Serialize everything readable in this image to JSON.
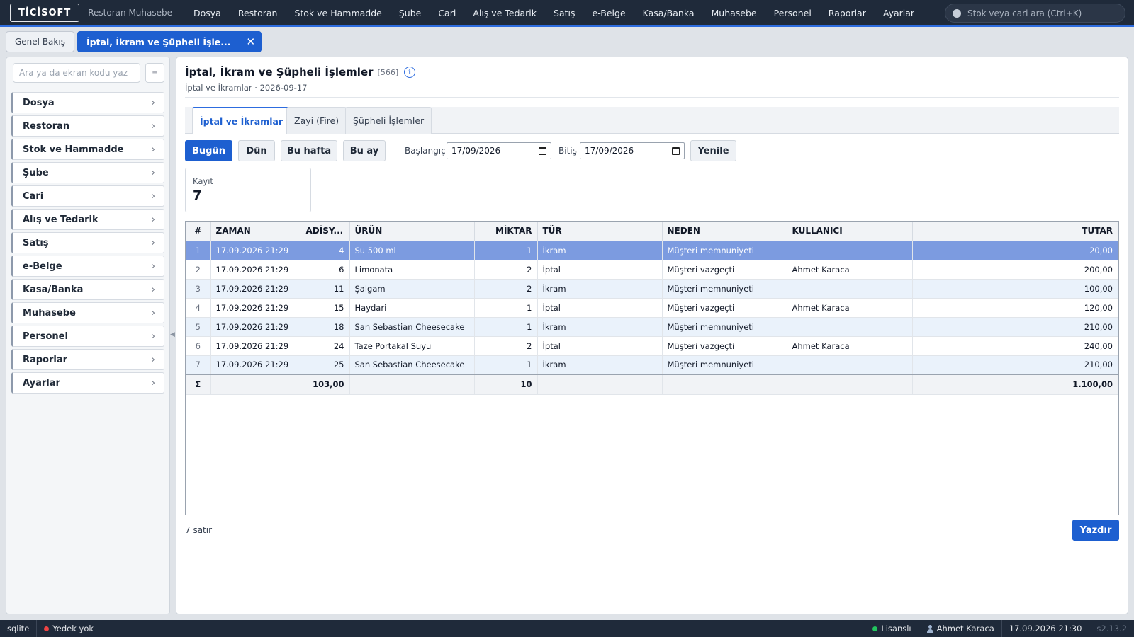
{
  "header": {
    "logo": "TİCİSOFT",
    "app_subtitle": "Restoran Muhasebe",
    "nav": [
      "Dosya",
      "Restoran",
      "Stok ve Hammadde",
      "Şube",
      "Cari",
      "Alış ve Tedarik",
      "Satış",
      "e-Belge",
      "Kasa/Banka",
      "Muhasebe",
      "Personel",
      "Raporlar",
      "Ayarlar"
    ],
    "search_placeholder": "Stok veya cari ara (Ctrl+K)"
  },
  "doc_tabs": {
    "home": "Genel Bakış",
    "active": "İptal, İkram ve Şüpheli İşle...",
    "close_glyph": "✕"
  },
  "sidebar": {
    "search_placeholder": "Ara ya da ekran kodu yaz",
    "menu_glyph": "≡",
    "items": [
      "Dosya",
      "Restoran",
      "Stok ve Hammadde",
      "Şube",
      "Cari",
      "Alış ve Tedarik",
      "Satış",
      "e-Belge",
      "Kasa/Banka",
      "Muhasebe",
      "Personel",
      "Raporlar",
      "Ayarlar"
    ],
    "chevron": "›"
  },
  "page": {
    "title": "İptal, İkram ve Şüpheli İşlemler",
    "count": "[566]",
    "info_glyph": "i",
    "breadcrumb": "İptal ve İkramlar · 2026-09-17"
  },
  "tabs": [
    "İptal ve İkramlar",
    "Zayi (Fire)",
    "Şüpheli İşlemler"
  ],
  "filters": {
    "today": "Bugün",
    "yesterday": "Dün",
    "this_week": "Bu hafta",
    "this_month": "Bu ay",
    "start_label": "Başlangıç",
    "start_value": "17/09/2026",
    "end_label": "Bitiş",
    "end_value": "17/09/2026",
    "refresh": "Yenile"
  },
  "stat": {
    "label": "Kayıt",
    "value": "7"
  },
  "table": {
    "columns": [
      "#",
      "ZAMAN",
      "ADİSY...",
      "ÜRÜN",
      "MİKTAR",
      "TÜR",
      "NEDEN",
      "KULLANICI",
      "TUTAR"
    ],
    "rows": [
      [
        "1",
        "17.09.2026 21:29",
        "4",
        "Su 500 ml",
        "1",
        "İkram",
        "Müşteri memnuniyeti",
        "",
        "20,00"
      ],
      [
        "2",
        "17.09.2026 21:29",
        "6",
        "Limonata",
        "2",
        "İptal",
        "Müşteri vazgeçti",
        "Ahmet Karaca",
        "200,00"
      ],
      [
        "3",
        "17.09.2026 21:29",
        "11",
        "Şalgam",
        "2",
        "İkram",
        "Müşteri memnuniyeti",
        "",
        "100,00"
      ],
      [
        "4",
        "17.09.2026 21:29",
        "15",
        "Haydari",
        "1",
        "İptal",
        "Müşteri vazgeçti",
        "Ahmet Karaca",
        "120,00"
      ],
      [
        "5",
        "17.09.2026 21:29",
        "18",
        "San Sebastian Cheesecake",
        "1",
        "İkram",
        "Müşteri memnuniyeti",
        "",
        "210,00"
      ],
      [
        "6",
        "17.09.2026 21:29",
        "24",
        "Taze Portakal Suyu",
        "2",
        "İptal",
        "Müşteri vazgeçti",
        "Ahmet Karaca",
        "240,00"
      ],
      [
        "7",
        "17.09.2026 21:29",
        "25",
        "San Sebastian Cheesecake",
        "1",
        "İkram",
        "Müşteri memnuniyeti",
        "",
        "210,00"
      ]
    ],
    "totals": [
      "Σ",
      "",
      "103,00",
      "",
      "10",
      "",
      "",
      "",
      "1.100,00"
    ],
    "selected_row": 0
  },
  "footer": {
    "row_count": "7 satır",
    "print": "Yazdır"
  },
  "status": {
    "db": "sqlite",
    "backup": "Yedek yok",
    "license": "Lisanslı",
    "user": "Ahmet Karaca",
    "datetime": "17.09.2026 21:30",
    "version": "s2.13.2"
  },
  "colors": {
    "accent": "#1d5fd0",
    "topbar": "#1f2a3a",
    "selected_row": "#7c9be0",
    "ok": "#22c55e",
    "warn": "#ef4444"
  }
}
